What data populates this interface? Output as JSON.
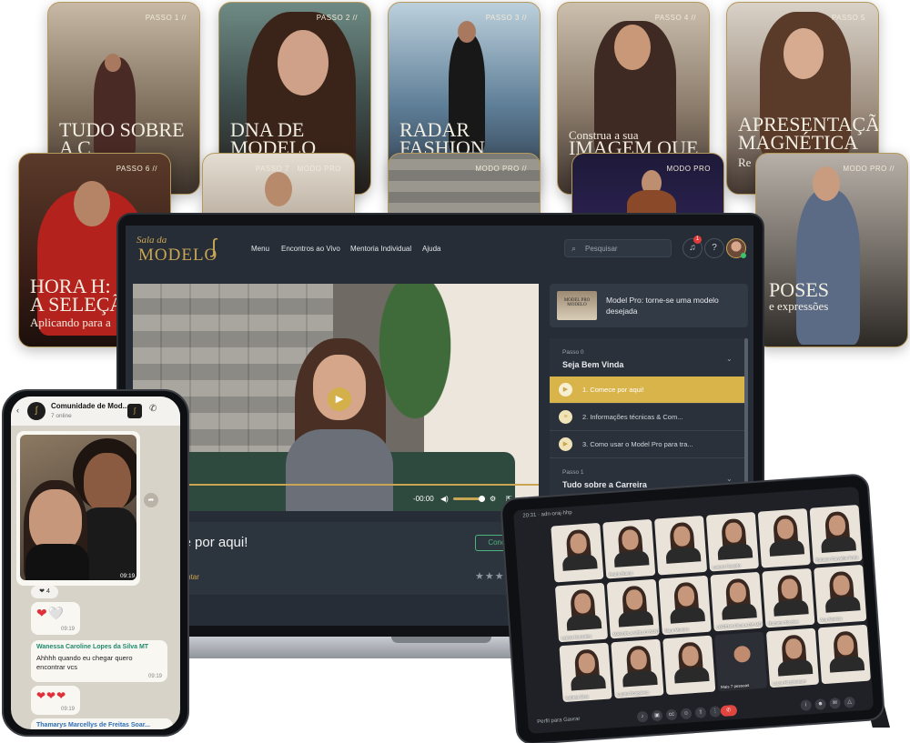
{
  "cards": [
    {
      "tag": "PASSO 1 //",
      "title": "TUDO SOBRE\nA C",
      "subtitle": ""
    },
    {
      "tag": "PASSO 2 //",
      "title": "DNA DE\nMODELO",
      "subtitle": ""
    },
    {
      "tag": "PASSO 3 //",
      "title": "RADAR\nFASHION",
      "subtitle": ""
    },
    {
      "tag": "PASSO 4 //",
      "title": "IMAGEM QUE",
      "subtitle": "Construa a sua"
    },
    {
      "tag": "PASSO 5",
      "title": "APRESENTAÇÃO\nMAGNÉTICA",
      "subtitle": "Re"
    },
    {
      "tag": "PASSO 6 //",
      "title": "HORA H:\nA SELEÇÃ",
      "subtitle": "Aplicando para a"
    },
    {
      "tag": "PASSO 7 · MODO PRO",
      "title": "",
      "subtitle": ""
    },
    {
      "tag": "MODO PRO //",
      "title": "",
      "subtitle": ""
    },
    {
      "tag": "MODO PRO",
      "title": "",
      "subtitle": ""
    },
    {
      "tag": "MODO PRO //",
      "title": "POSES",
      "subtitle": "e expressões"
    }
  ],
  "laptop": {
    "logo_script": "Sala da",
    "logo_main": "MODELO",
    "nav": [
      "Menu",
      "Encontros ao Vivo",
      "Mentoria Individual",
      "Ajuda"
    ],
    "search_placeholder": "Pesquisar",
    "notification_count": "1",
    "video": {
      "time": "-00:00"
    },
    "lesson": {
      "title": "ce por aqui!",
      "conclude": "Concluir",
      "comment": "mentar",
      "stars": "★★★★★"
    },
    "course": {
      "thumb": "MODEL PRO MODELO",
      "title": "Model Pro: torne-se uma modelo desejada"
    },
    "modules": [
      {
        "label": "Passo 0",
        "title": "Seja Bem Vinda"
      },
      {
        "label": "Passo 1",
        "title": "Tudo sobre a Carreira"
      }
    ],
    "items": [
      "1. Comece por aqui!",
      "2. Informações técnicas & Com...",
      "3. Como usar o Model Pro para tra..."
    ]
  },
  "phone": {
    "group_name": "Comunidade de Mod...",
    "online": "7 online",
    "photo_time": "09:19",
    "reaction": "❤ 4",
    "msg1": {
      "hearts": "❤🤍",
      "time": "09:19"
    },
    "msg2": {
      "author": "Wanessa Caroline Lopes da Silva MT",
      "text": "Ahhhh quando eu chegar quero encontrar vcs",
      "time": "09:19"
    },
    "msg3": {
      "hearts": "❤❤❤",
      "time": "09:19"
    },
    "msg4": {
      "author": "Thamarys Marcellys de Freitas Soar..."
    }
  },
  "tablet": {
    "top_left": "20:31 · adn-oraj-hhp",
    "bottom_left": "Perfil para Gavrar",
    "participants": [
      "",
      "Pedra Bueno",
      "",
      "Lorena Canedo",
      "",
      "Rafaela Carvalho Frota",
      "Leticia Gonzalez",
      "MANUELA MELLO SANTOS",
      "Nara Moreira",
      "LORENA PAULA DE MORI",
      "Romanu Nicoleu",
      "Ana Martins",
      "Isabela Silva",
      "Luana Dosgalves",
      "",
      "Mais 7 pessoas",
      "Laura Hirschmann",
      ""
    ]
  }
}
